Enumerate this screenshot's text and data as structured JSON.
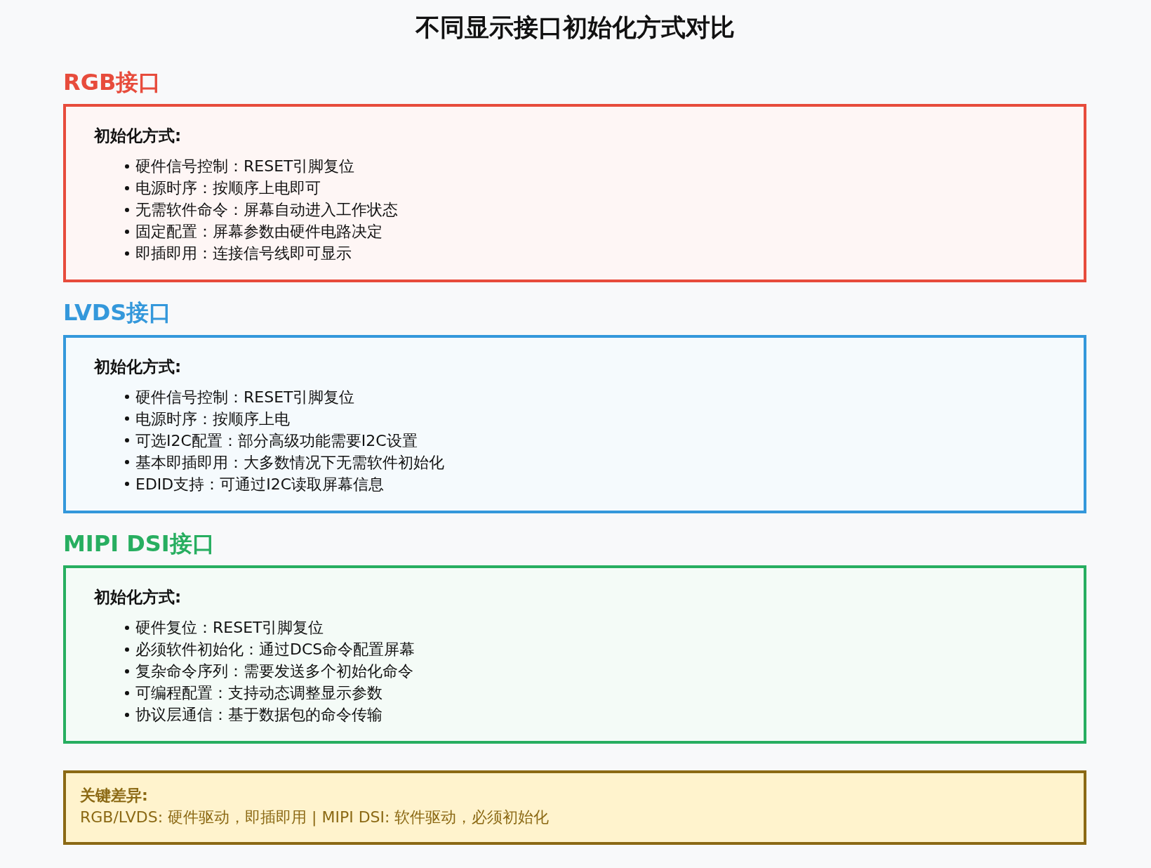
{
  "title": "不同显示接口初始化方式对比",
  "sections": [
    {
      "heading": "RGB接口",
      "color": "#e74c3c",
      "label": "初始化方式:",
      "items": [
        "硬件信号控制：RESET引脚复位",
        "电源时序：按顺序上电即可",
        "无需软件命令：屏幕自动进入工作状态",
        "固定配置：屏幕参数由硬件电路决定",
        "即插即用：连接信号线即可显示"
      ]
    },
    {
      "heading": "LVDS接口",
      "color": "#3498db",
      "label": "初始化方式:",
      "items": [
        "硬件信号控制：RESET引脚复位",
        "电源时序：按顺序上电",
        "可选I2C配置：部分高级功能需要I2C设置",
        "基本即插即用：大多数情况下无需软件初始化",
        "EDID支持：可通过I2C读取屏幕信息"
      ]
    },
    {
      "heading": "MIPI DSI接口",
      "color": "#27ae60",
      "label": "初始化方式:",
      "items": [
        "硬件复位：RESET引脚复位",
        "必须软件初始化：通过DCS命令配置屏幕",
        "复杂命令序列：需要发送多个初始化命令",
        "可编程配置：支持动态调整显示参数",
        "协议层通信：基于数据包的命令传输"
      ]
    }
  ],
  "key_difference": {
    "label": "关键差异:",
    "text": "RGB/LVDS: 硬件驱动，即插即用 | MIPI DSI: 软件驱动，必须初始化"
  }
}
